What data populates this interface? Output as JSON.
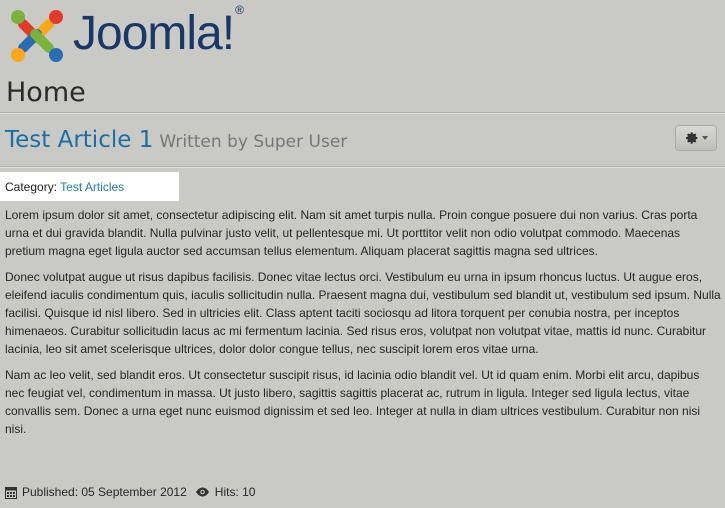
{
  "site": {
    "logo_text": "Joomla!",
    "registered": "®"
  },
  "page": {
    "title": "Home"
  },
  "article": {
    "title": "Test Article 1",
    "byline": "Written by Super User",
    "category_label": "Category:",
    "category_name": "Test Articles",
    "paragraphs": [
      "Lorem ipsum dolor sit amet, consectetur adipiscing elit. Nam sit amet turpis nulla. Proin congue posuere dui non varius. Cras porta urna et dui gravida blandit. Nulla pulvinar justo velit, ut pellentesque mi. Ut porttitor velit non odio volutpat commodo. Maecenas pretium magna eget ligula auctor sed accumsan tellus elementum. Aliquam placerat sagittis magna sed ultrices.",
      "Donec volutpat augue ut risus dapibus facilisis. Donec vitae lectus orci. Vestibulum eu urna in ipsum rhoncus luctus. Ut augue eros, eleifend iaculis condimentum quis, iaculis sollicitudin nulla. Praesent magna dui, vestibulum sed blandit ut, vestibulum sed ipsum. Nulla facilisi. Quisque id nisl libero. Sed in ultricies elit. Class aptent taciti sociosqu ad litora torquent per conubia nostra, per inceptos himenaeos. Curabitur sollicitudin lacus ac mi fermentum lacinia. Sed risus eros, volutpat non volutpat vitae, mattis id nunc. Curabitur lacinia, leo sit amet scelerisque ultrices, dolor dolor congue tellus, nec suscipit lorem eros vitae urna.",
      "Nam ac leo velit, sed blandit eros. Ut consectetur suscipit risus, id lacinia odio blandit vel. Ut id quam enim. Morbi elit arcu, dapibus nec feugiat vel, condimentum in massa. Ut justo libero, sagittis sagittis placerat ac, rutrum in ligula. Integer sed ligula lectus, vitae convallis sem. Donec a urna eget nunc euismod dignissim et sed leo. Integer at nulla in diam ultrices vestibulum. Curabitur non nisi nisi."
    ],
    "published": "Published: 05 September 2012",
    "hits": "Hits: 10"
  },
  "icons": {
    "gear": "gear-icon",
    "calendar": "calendar-icon",
    "hits": "eye-icon",
    "caret": "chevron-down-icon"
  },
  "colors": {
    "background": "#c9cac5",
    "link": "#1c6ea4",
    "logo_text": "#1a3867"
  }
}
